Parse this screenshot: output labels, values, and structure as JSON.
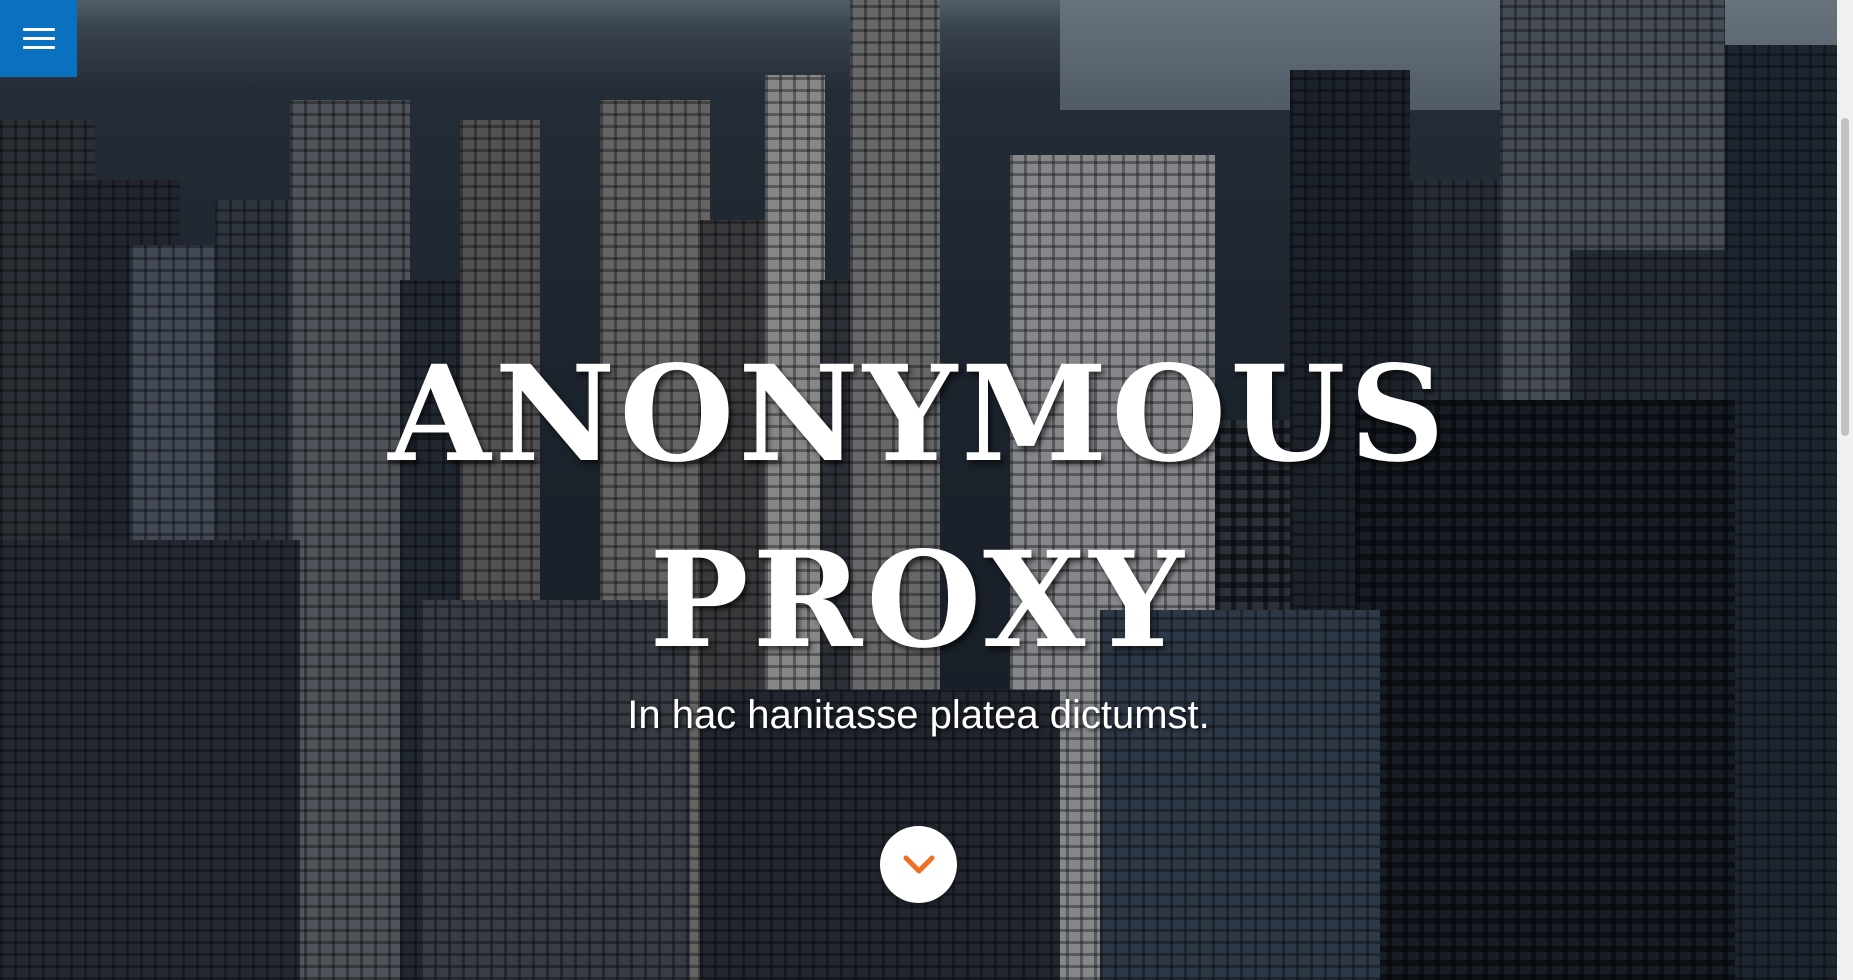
{
  "hero": {
    "title_line1": "ANONYMOUS",
    "title_line2": "PROXY",
    "subtitle": "In hac hanitasse platea dictumst."
  },
  "menu_button": {
    "icon": "hamburger-menu-icon"
  },
  "scroll_button": {
    "icon": "chevron-down-icon"
  },
  "colors": {
    "menu_background": "#0a70c0",
    "chevron": "#f26f21",
    "text": "#ffffff"
  }
}
